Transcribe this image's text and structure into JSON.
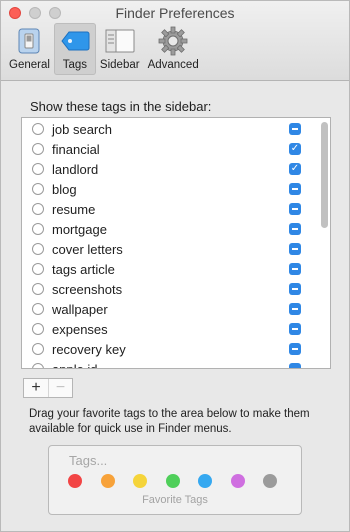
{
  "window": {
    "title": "Finder Preferences"
  },
  "toolbar": {
    "items": [
      {
        "label": "General",
        "icon": "general-switch-icon"
      },
      {
        "label": "Tags",
        "icon": "tag-icon",
        "selected": true
      },
      {
        "label": "Sidebar",
        "icon": "sidebar-window-icon"
      },
      {
        "label": "Advanced",
        "icon": "gear-icon"
      }
    ]
  },
  "tags_section": {
    "label": "Show these tags in the sidebar:",
    "tags": [
      {
        "name": "job search",
        "state": "mixed"
      },
      {
        "name": "financial",
        "state": "checked"
      },
      {
        "name": "landlord",
        "state": "checked"
      },
      {
        "name": "blog",
        "state": "mixed"
      },
      {
        "name": "resume",
        "state": "mixed"
      },
      {
        "name": "mortgage",
        "state": "mixed"
      },
      {
        "name": "cover letters",
        "state": "mixed"
      },
      {
        "name": "tags article",
        "state": "mixed"
      },
      {
        "name": "screenshots",
        "state": "mixed"
      },
      {
        "name": "wallpaper",
        "state": "mixed"
      },
      {
        "name": "expenses",
        "state": "mixed"
      },
      {
        "name": "recovery key",
        "state": "mixed"
      },
      {
        "name": "apple id",
        "state": "mixed"
      }
    ]
  },
  "buttons": {
    "add": "+",
    "remove": "−"
  },
  "help_text": "Drag your favorite tags to the area below to make them available for quick use in Finder menus.",
  "favorites": {
    "placeholder": "Tags...",
    "caption": "Favorite Tags",
    "colors": [
      "#f24545",
      "#f7a23a",
      "#f5d43a",
      "#4fcf5a",
      "#35a8f0",
      "#cf6fe0",
      "#9b9b9b"
    ]
  },
  "colors": {
    "accent": "#2f87e5",
    "close": "#fc5f57"
  }
}
